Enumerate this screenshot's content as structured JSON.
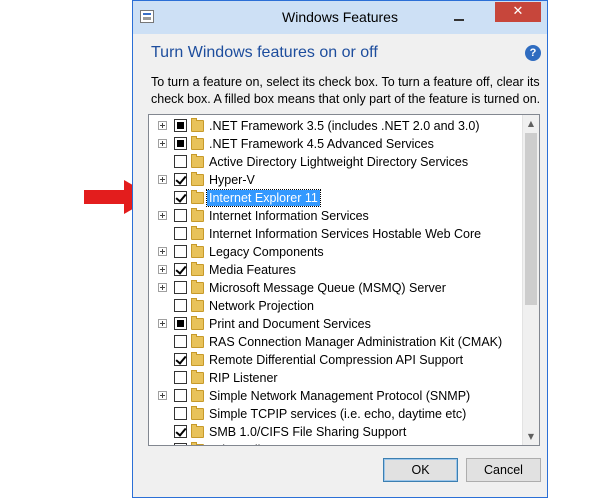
{
  "window": {
    "title": "Windows Features",
    "close_glyph": "✕"
  },
  "heading": "Turn Windows features on or off",
  "help_glyph": "?",
  "description": "To turn a feature on, select its check box. To turn a feature off, clear its check box. A filled box means that only part of the feature is turned on.",
  "features": [
    {
      "label": ".NET Framework 3.5 (includes .NET 2.0 and 3.0)",
      "expandable": true,
      "state": "partial"
    },
    {
      "label": ".NET Framework 4.5 Advanced Services",
      "expandable": true,
      "state": "partial"
    },
    {
      "label": "Active Directory Lightweight Directory Services",
      "expandable": false,
      "state": "unchecked"
    },
    {
      "label": "Hyper-V",
      "expandable": true,
      "state": "checked"
    },
    {
      "label": "Internet Explorer 11",
      "expandable": false,
      "state": "checked",
      "selected": true
    },
    {
      "label": "Internet Information Services",
      "expandable": true,
      "state": "unchecked"
    },
    {
      "label": "Internet Information Services Hostable Web Core",
      "expandable": false,
      "state": "unchecked"
    },
    {
      "label": "Legacy Components",
      "expandable": true,
      "state": "unchecked"
    },
    {
      "label": "Media Features",
      "expandable": true,
      "state": "checked"
    },
    {
      "label": "Microsoft Message Queue (MSMQ) Server",
      "expandable": true,
      "state": "unchecked"
    },
    {
      "label": "Network Projection",
      "expandable": false,
      "state": "unchecked"
    },
    {
      "label": "Print and Document Services",
      "expandable": true,
      "state": "partial"
    },
    {
      "label": "RAS Connection Manager Administration Kit (CMAK)",
      "expandable": false,
      "state": "unchecked"
    },
    {
      "label": "Remote Differential Compression API Support",
      "expandable": false,
      "state": "checked"
    },
    {
      "label": "RIP Listener",
      "expandable": false,
      "state": "unchecked"
    },
    {
      "label": "Simple Network Management Protocol (SNMP)",
      "expandable": true,
      "state": "unchecked"
    },
    {
      "label": "Simple TCPIP services (i.e. echo, daytime etc)",
      "expandable": false,
      "state": "unchecked"
    },
    {
      "label": "SMB 1.0/CIFS File Sharing Support",
      "expandable": false,
      "state": "checked"
    },
    {
      "label": "Telnet Client",
      "expandable": false,
      "state": "unchecked"
    }
  ],
  "buttons": {
    "ok": "OK",
    "cancel": "Cancel"
  },
  "colors": {
    "annotation_arrow": "#e31d1d",
    "selection": "#3399ff",
    "heading": "#1d4d9d",
    "close_button": "#c7463b"
  },
  "icons": {
    "app": "windows-features-app-icon",
    "help": "help-icon",
    "folder": "folder-icon",
    "expander": "plus-expander-icon",
    "annotation": "red-arrow-icon"
  }
}
